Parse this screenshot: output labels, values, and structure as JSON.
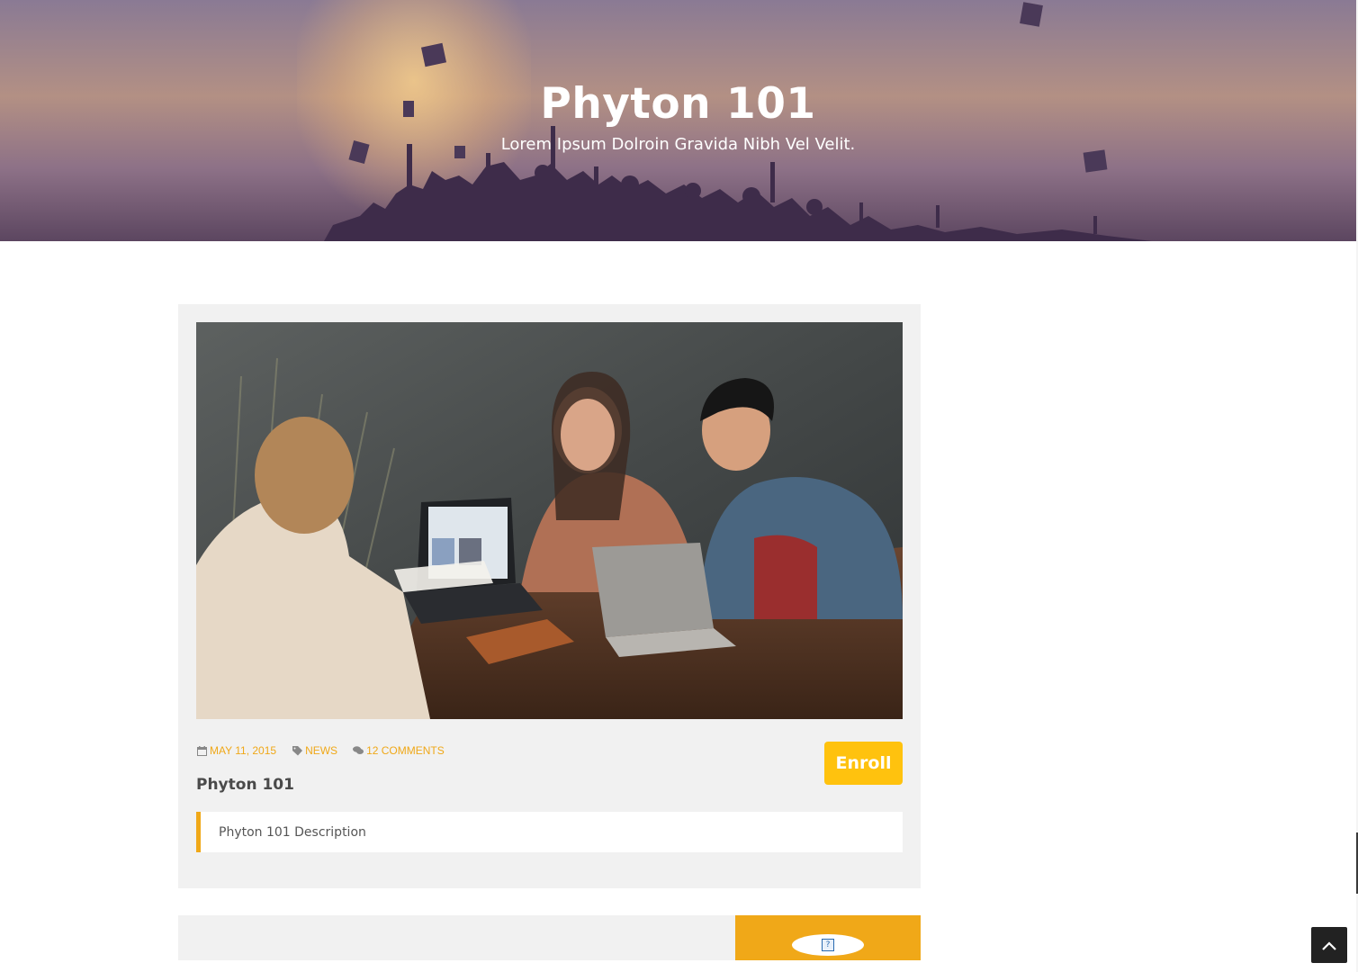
{
  "hero": {
    "title": "Phyton 101",
    "subtitle": "Lorem Ipsum Dolroin Gravida Nibh Vel Velit."
  },
  "post": {
    "meta": {
      "date": "MAY 11, 2015",
      "category": "NEWS",
      "comments": "12 COMMENTS"
    },
    "title": "Phyton 101",
    "description": "Phyton 101 Description",
    "enroll_label": "Enroll"
  },
  "bottom": {
    "broken_image_glyph": "?"
  },
  "icons": {
    "date": "calendar-icon",
    "category": "tag-icon",
    "comments": "comments-icon",
    "back_to_top": "chevron-up-icon"
  },
  "colors": {
    "accent": "#f0a818",
    "enroll_button": "#ffc20e",
    "card_background": "#f1f1f1",
    "back_to_top": "#222222"
  }
}
